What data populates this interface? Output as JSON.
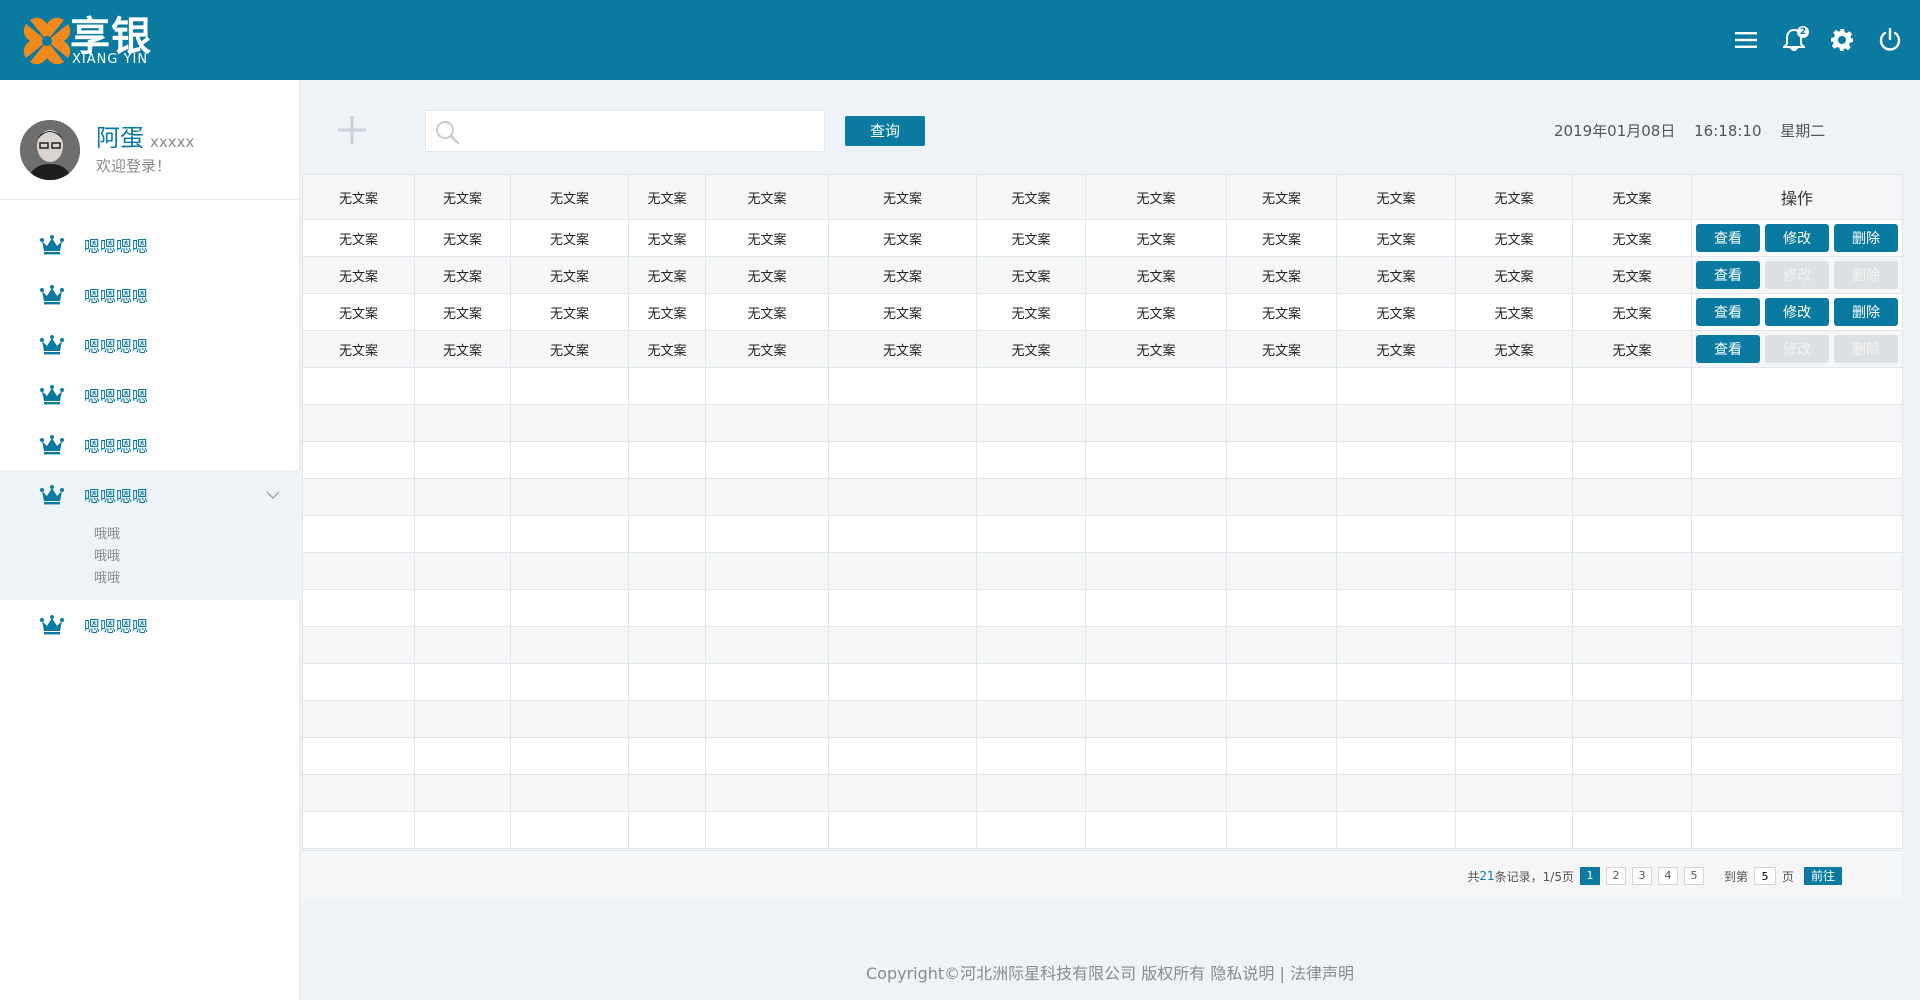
{
  "brand": {
    "cn": "享银",
    "en": "XIANG YIN",
    "accent": "#0b7aa0",
    "logo_color": "#f08a1c"
  },
  "header": {
    "icons": [
      "menu-icon",
      "bell-icon",
      "gear-icon",
      "power-icon"
    ],
    "notification_count": "2"
  },
  "user": {
    "name": "阿蛋",
    "sub": "xxxxx",
    "welcome": "欢迎登录！"
  },
  "sidebar": {
    "items": [
      {
        "label": "嗯嗯嗯嗯",
        "icon": "crown-icon"
      },
      {
        "label": "嗯嗯嗯嗯",
        "icon": "crown-icon"
      },
      {
        "label": "嗯嗯嗯嗯",
        "icon": "crown-icon"
      },
      {
        "label": "嗯嗯嗯嗯",
        "icon": "crown-icon"
      },
      {
        "label": "嗯嗯嗯嗯",
        "icon": "crown-icon"
      },
      {
        "label": "嗯嗯嗯嗯",
        "icon": "crown-icon",
        "expanded": true,
        "children": [
          "哦哦",
          "哦哦",
          "哦哦"
        ]
      },
      {
        "label": "嗯嗯嗯嗯",
        "icon": "crown-icon"
      }
    ]
  },
  "toolbar": {
    "search_placeholder": "",
    "search_value": "",
    "query_label": "查询",
    "date": "2019年01月08日",
    "time": "16:18:10",
    "weekday": "星期二"
  },
  "table": {
    "headers": [
      "无文案",
      "无文案",
      "无文案",
      "无文案",
      "无文案",
      "无文案",
      "无文案",
      "无文案",
      "无文案",
      "无文案",
      "无文案",
      "无文案"
    ],
    "ops_header": "操作",
    "rows": [
      {
        "cells": [
          "无文案",
          "无文案",
          "无文案",
          "无文案",
          "无文案",
          "无文案",
          "无文案",
          "无文案",
          "无文案",
          "无文案",
          "无文案",
          "无文案"
        ],
        "edit_enabled": true,
        "delete_enabled": true
      },
      {
        "cells": [
          "无文案",
          "无文案",
          "无文案",
          "无文案",
          "无文案",
          "无文案",
          "无文案",
          "无文案",
          "无文案",
          "无文案",
          "无文案",
          "无文案"
        ],
        "edit_enabled": false,
        "delete_enabled": false
      },
      {
        "cells": [
          "无文案",
          "无文案",
          "无文案",
          "无文案",
          "无文案",
          "无文案",
          "无文案",
          "无文案",
          "无文案",
          "无文案",
          "无文案",
          "无文案"
        ],
        "edit_enabled": true,
        "delete_enabled": true
      },
      {
        "cells": [
          "无文案",
          "无文案",
          "无文案",
          "无文案",
          "无文案",
          "无文案",
          "无文案",
          "无文案",
          "无文案",
          "无文案",
          "无文案",
          "无文案"
        ],
        "edit_enabled": false,
        "delete_enabled": false
      }
    ],
    "empty_rows": 13,
    "view_label": "查看",
    "edit_label": "修改",
    "delete_label": "删除"
  },
  "pagination": {
    "total_prefix": "共",
    "total": "21",
    "total_suffix": "条记录，1/5页",
    "pages": [
      "1",
      "2",
      "3",
      "4",
      "5"
    ],
    "current": "1",
    "goto_prefix": "到第",
    "goto_value": "5",
    "goto_suffix": "页",
    "go_label": "前往"
  },
  "footer": {
    "copyright": "Copyright©河北洲际星科技有限公司 版权所有",
    "privacy": "隐私说明",
    "sep": "|",
    "legal": "法律声明"
  }
}
